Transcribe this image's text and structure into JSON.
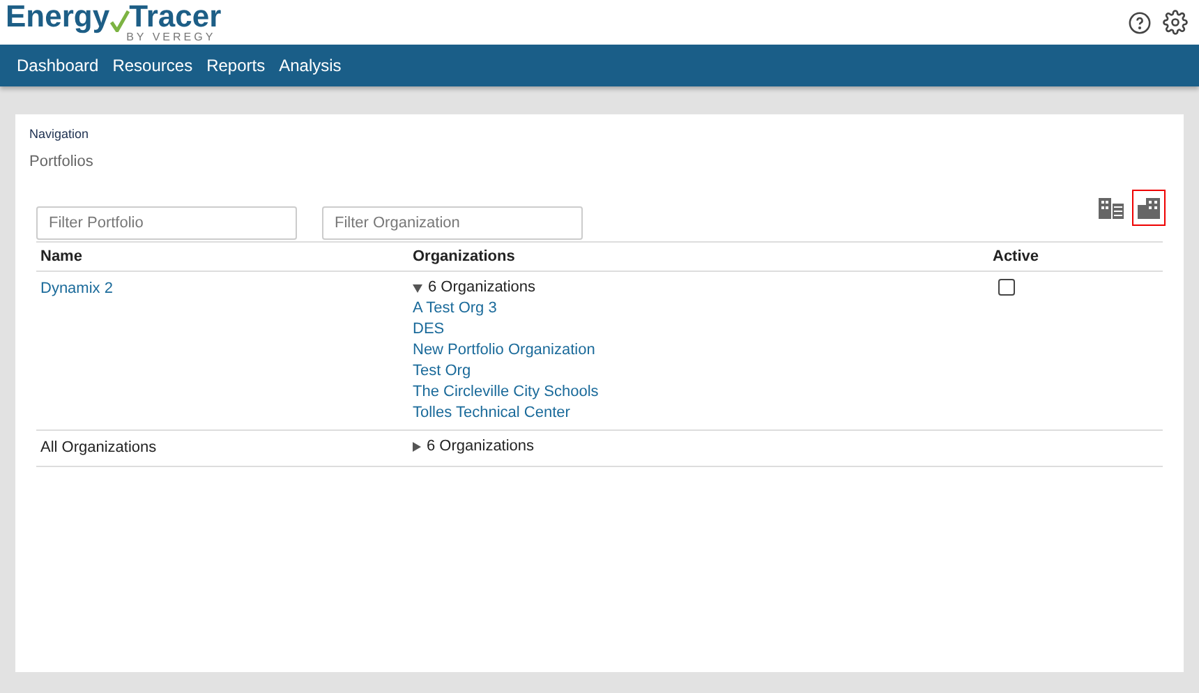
{
  "logo": {
    "first": "Energy",
    "second": "Tracer",
    "tagline": "BY VEREGY"
  },
  "menu": [
    {
      "label": "Dashboard"
    },
    {
      "label": "Resources"
    },
    {
      "label": "Reports"
    },
    {
      "label": "Analysis"
    }
  ],
  "breadcrumb": {
    "label": "Navigation",
    "title": "Portfolios"
  },
  "filters": [
    {
      "placeholder": "Filter Portfolio"
    },
    {
      "placeholder": "Filter Organization"
    }
  ],
  "view_toggles": [
    {
      "kind": "list",
      "selected": false
    },
    {
      "kind": "grid",
      "selected": true
    }
  ],
  "table": {
    "columns": [
      "Name",
      "Organizations",
      "Active"
    ],
    "rows": [
      {
        "name": "Dynamix 2",
        "link": true,
        "expanded": true,
        "count": "6 Organizations",
        "organizations": [
          "A Test Org 3",
          "DES",
          "New Portfolio Organization",
          "Test Org",
          "The Circleville City Schools",
          "Tolles Technical Center"
        ],
        "active": false
      },
      {
        "name": "All Organizations",
        "link": false,
        "expanded": false,
        "count": "6 Organizations"
      }
    ]
  }
}
